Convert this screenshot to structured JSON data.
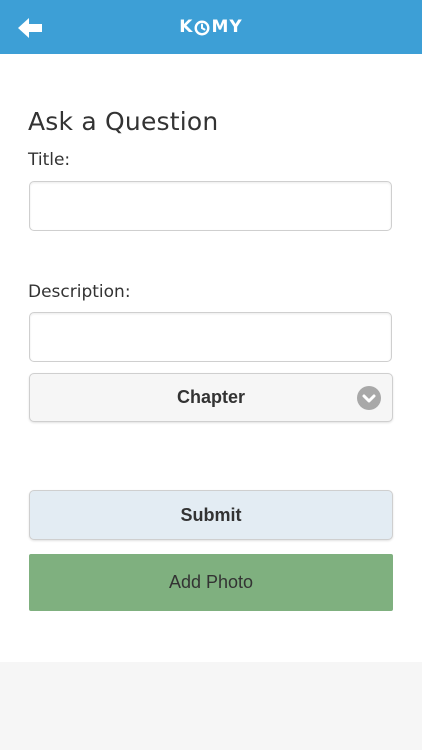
{
  "header": {
    "logo_left": "K",
    "logo_right": "MY",
    "back_icon": "arrow-left-icon",
    "color": "#3d9fd6"
  },
  "form": {
    "heading": "Ask a Question",
    "title_label": "Title:",
    "title_value": "",
    "description_label": "Description:",
    "description_value": "",
    "chapter_select": "Chapter",
    "chevron_icon": "chevron-down-icon"
  },
  "actions": {
    "submit_label": "Submit",
    "add_photo_label": "Add Photo",
    "add_photo_color": "#7fb07f"
  }
}
